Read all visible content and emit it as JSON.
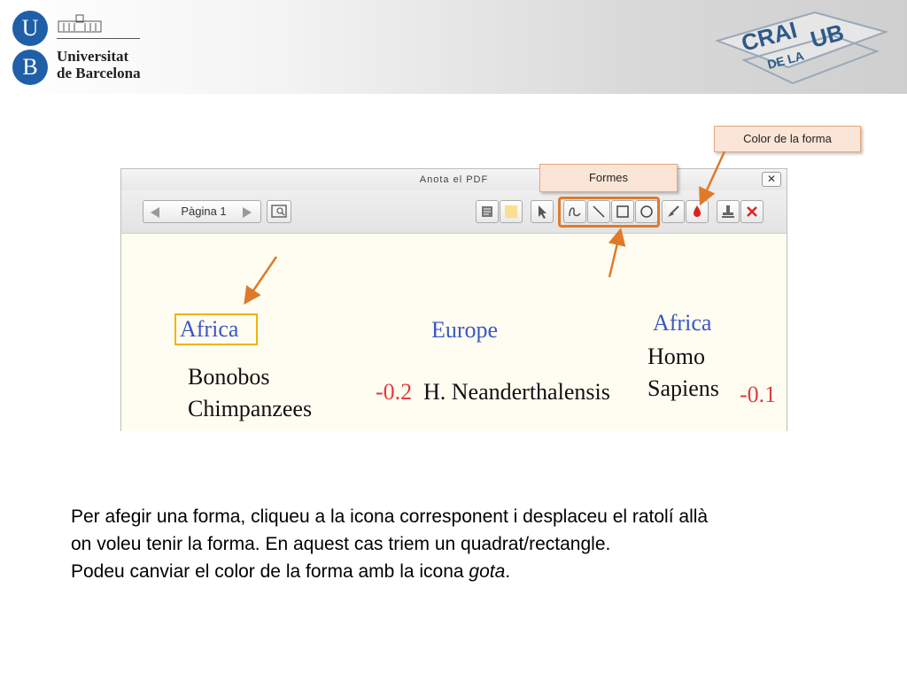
{
  "header": {
    "logo": {
      "letter_top": "U",
      "letter_bottom": "B",
      "name_line1": "Universitat",
      "name_line2": "de Barcelona"
    },
    "crai_logo": {
      "word1": "CRAI",
      "word2": "DE LA",
      "word3": "UB"
    }
  },
  "callouts": {
    "color": "Color de la forma",
    "formes": "Formes"
  },
  "window": {
    "title": "Anota el PDF",
    "close_glyph": "✕",
    "pager": {
      "page_label": "Pàgina 1"
    },
    "tools": [
      {
        "name": "comment-icon"
      },
      {
        "name": "highlight-icon"
      },
      {
        "name": "select-arrow-icon"
      },
      {
        "name": "freehand-pen-icon"
      },
      {
        "name": "line-icon"
      },
      {
        "name": "rectangle-icon"
      },
      {
        "name": "oval-icon"
      },
      {
        "name": "color-brush-icon"
      },
      {
        "name": "color-drop-icon"
      },
      {
        "name": "stamp-icon"
      },
      {
        "name": "delete-icon"
      }
    ],
    "document": {
      "africa_left": "Africa",
      "europe": "Europe",
      "africa_right": "Africa",
      "bonobos": "Bonobos",
      "chimpanzees": "Chimpanzees",
      "value_left": "-0.2",
      "neanderthalensis": "H. Neanderthalensis",
      "homo": "Homo",
      "sapiens": "Sapiens",
      "value_right": "-0.1"
    }
  },
  "body": {
    "line1": "Per afegir una forma, cliqueu a la icona corresponent i desplaceu el ratolí allà",
    "line2": "on voleu tenir la forma. En aquest cas triem un quadrat/rectangle.",
    "line3_prefix": "Podeu canviar el color de la forma amb la icona ",
    "line3_italic": "gota",
    "line3_suffix": "."
  },
  "colors": {
    "highlight_orange": "#e07a2b",
    "callout_fill": "#fbe5d6",
    "doc_blue": "#3a57c4",
    "doc_red": "#e23b3b",
    "box_yellow": "#f0b400",
    "ub_blue": "#1f5fa8"
  }
}
